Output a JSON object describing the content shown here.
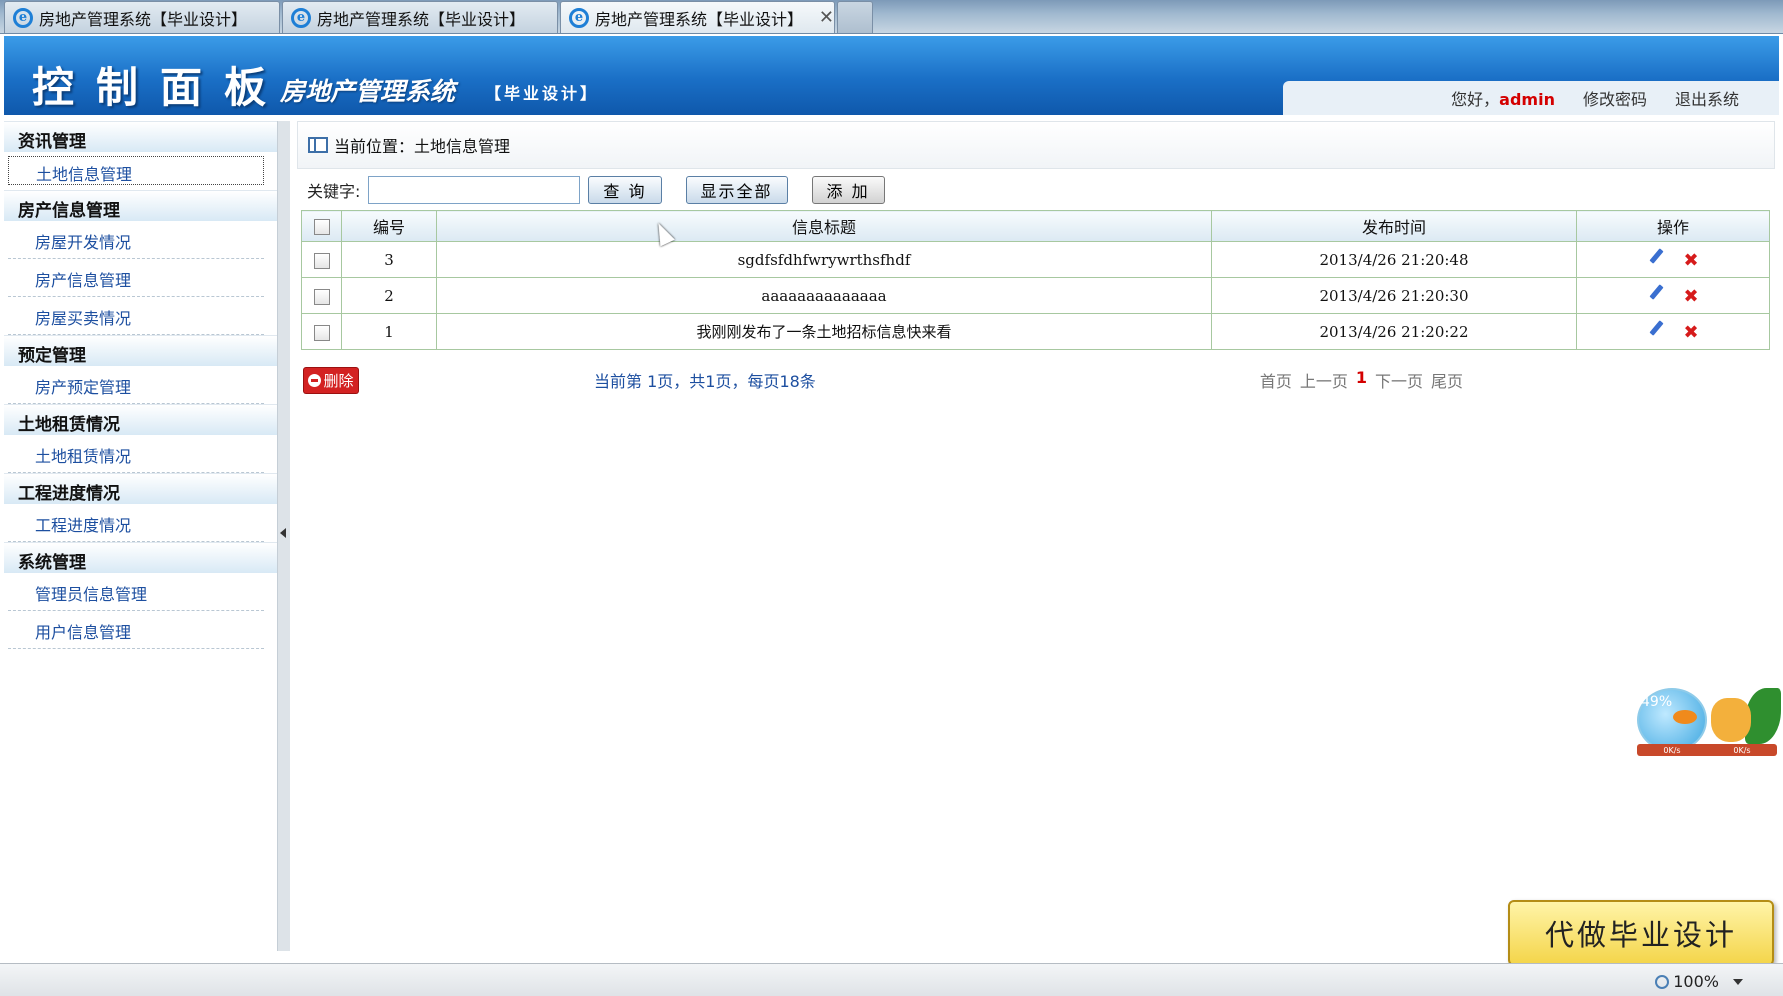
{
  "browser": {
    "tabs": [
      {
        "title": "房地产管理系统【毕业设计】",
        "active": false
      },
      {
        "title": "房地产管理系统【毕业设计】",
        "active": false
      },
      {
        "title": "房地产管理系统【毕业设计】",
        "active": true
      }
    ],
    "zoom": "100%"
  },
  "header": {
    "title": "控制面板",
    "subtitle": "房地产管理系统",
    "tag": "【毕业设计】",
    "greeting": "您好，",
    "username": "admin",
    "change_password": "修改密码",
    "logout": "退出系统"
  },
  "sidebar": {
    "sections": [
      {
        "title": "资讯管理",
        "items": [
          "土地信息管理"
        ]
      },
      {
        "title": "房产信息管理",
        "items": [
          "房屋开发情况",
          "房产信息管理",
          "房屋买卖情况"
        ]
      },
      {
        "title": "预定管理",
        "items": [
          "房产预定管理"
        ]
      },
      {
        "title": "土地租赁情况",
        "items": [
          "土地租赁情况"
        ]
      },
      {
        "title": "工程进度情况",
        "items": [
          "工程进度情况"
        ]
      },
      {
        "title": "系统管理",
        "items": [
          "管理员信息管理",
          "用户信息管理"
        ]
      }
    ]
  },
  "main": {
    "breadcrumb": "当前位置：土地信息管理",
    "search": {
      "label": "关键字:",
      "value": "",
      "query_button": "查 询",
      "show_all_button": "显示全部",
      "add_button": "添 加"
    },
    "table": {
      "headers": [
        "编号",
        "信息标题",
        "发布时间",
        "操作"
      ],
      "rows": [
        {
          "id": "3",
          "title": "sgdfsfdhfwrywrthsfhdf",
          "time": "2013/4/26 21:20:48"
        },
        {
          "id": "2",
          "title": "aaaaaaaaaaaaaa",
          "time": "2013/4/26 21:20:30"
        },
        {
          "id": "1",
          "title": "我刚刚发布了一条土地招标信息快来看",
          "time": "2013/4/26 21:20:22"
        }
      ]
    },
    "delete_button": "删除",
    "page_info": "当前第 1页，共1页，每页18条",
    "pager": {
      "first": "首页",
      "prev": "上一页",
      "current": "1",
      "next": "下一页",
      "last": "尾页"
    }
  },
  "widget": {
    "percent": "49%",
    "up": "0K/s",
    "down": "0K/s"
  },
  "ad": {
    "text": "代做毕业设计"
  },
  "colors": {
    "header_blue": "#1a6fc6",
    "accent_red": "#d40000",
    "link_blue": "#1d4fa0",
    "table_border": "#a7c8a0"
  }
}
